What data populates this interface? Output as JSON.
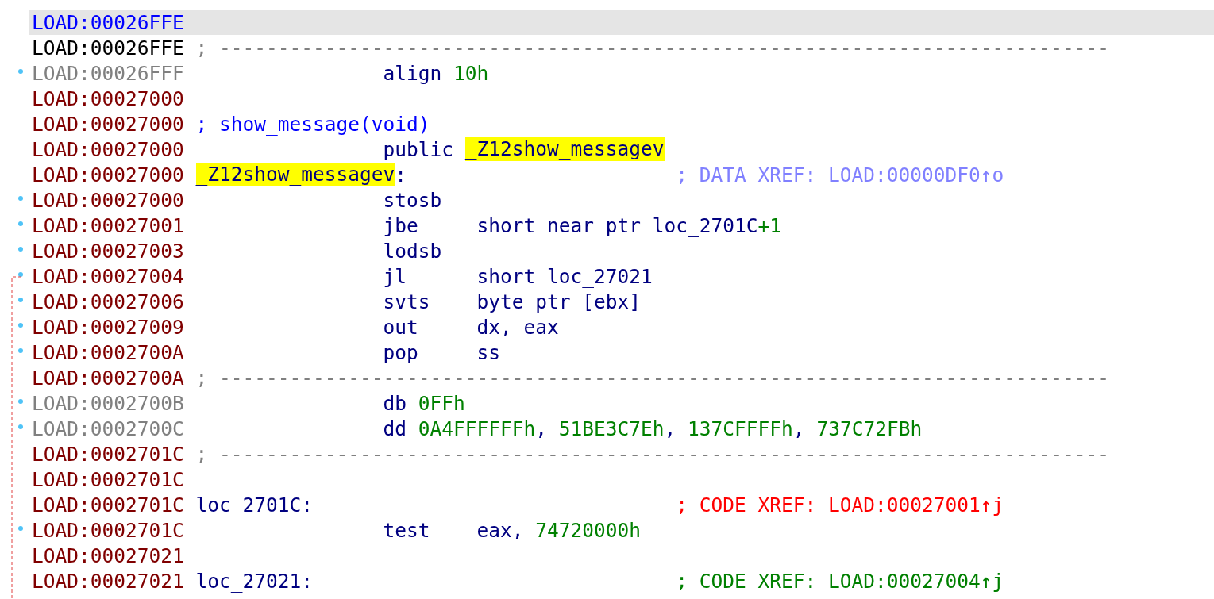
{
  "listing": {
    "lines": [
      {
        "address": "LOAD:00026FFE",
        "selected": true,
        "marker": false
      },
      {
        "address": "LOAD:00026FFE",
        "kind": "plain",
        "selected": false,
        "marker": false,
        "tokens": [
          {
            "kind": "separator",
            "parts": [
              {
                "text": "; ----------------------------------------------------------------------------",
                "kind": "separator"
              }
            ]
          }
        ]
      },
      {
        "address": "LOAD:00026FFF",
        "kind": "data",
        "selected": false,
        "marker": true,
        "tokens": [
          {
            "kind": "directive",
            "parts": [
              {
                "text": "align",
                "kind": "symbol"
              }
            ]
          },
          {
            "kind": "operands",
            "parts": [
              {
                "text": "10h",
                "kind": "number"
              }
            ]
          }
        ]
      },
      {
        "address": "LOAD:00027000",
        "kind": "code",
        "selected": false,
        "marker": false
      },
      {
        "address": "LOAD:00027000",
        "kind": "code",
        "selected": false,
        "marker": false,
        "tokens": [
          {
            "kind": "heading",
            "parts": [
              {
                "text": "; show_message(void)",
                "kind": "function"
              }
            ]
          }
        ]
      },
      {
        "address": "LOAD:00027000",
        "kind": "code",
        "selected": false,
        "marker": false,
        "tokens": [
          {
            "kind": "directive",
            "parts": [
              {
                "text": "public",
                "kind": "symbol"
              }
            ]
          },
          {
            "kind": "operands",
            "parts": [
              {
                "text": "_Z12show_messagev",
                "kind": "symbol",
                "highlighted": true
              }
            ]
          }
        ]
      },
      {
        "address": "LOAD:00027000",
        "kind": "code",
        "selected": false,
        "marker": false,
        "tokens": [
          {
            "kind": "label",
            "parts": [
              {
                "text": "_Z12show_messagev",
                "kind": "symbol",
                "highlighted": true
              },
              {
                "text": ":",
                "kind": "symbol"
              }
            ]
          },
          {
            "kind": "comment",
            "color": "#8080ff",
            "parts": [
              {
                "text": "; DATA XREF: LOAD:00000DF0↑o"
              }
            ]
          }
        ]
      },
      {
        "address": "LOAD:00027000",
        "kind": "code",
        "selected": false,
        "marker": true,
        "tokens": [
          {
            "kind": "mnemonic",
            "parts": [
              {
                "text": "stosb",
                "kind": "symbol"
              }
            ]
          }
        ]
      },
      {
        "address": "LOAD:00027001",
        "kind": "code",
        "selected": false,
        "marker": true,
        "tokens": [
          {
            "kind": "mnemonic",
            "parts": [
              {
                "text": "jbe",
                "kind": "symbol"
              }
            ]
          },
          {
            "kind": "operands",
            "parts": [
              {
                "text": "short near ptr loc_2701C",
                "kind": "symbol"
              },
              {
                "text": "+1",
                "kind": "number"
              }
            ]
          }
        ]
      },
      {
        "address": "LOAD:00027003",
        "kind": "code",
        "selected": false,
        "marker": true,
        "tokens": [
          {
            "kind": "mnemonic",
            "parts": [
              {
                "text": "lodsb",
                "kind": "symbol"
              }
            ]
          }
        ]
      },
      {
        "address": "LOAD:00027004",
        "kind": "code",
        "selected": false,
        "marker": true,
        "tokens": [
          {
            "kind": "mnemonic",
            "parts": [
              {
                "text": "jl",
                "kind": "symbol"
              }
            ]
          },
          {
            "kind": "operands",
            "parts": [
              {
                "text": "short loc_27021",
                "kind": "symbol"
              }
            ]
          }
        ]
      },
      {
        "address": "LOAD:00027006",
        "kind": "code",
        "selected": false,
        "marker": true,
        "tokens": [
          {
            "kind": "mnemonic",
            "parts": [
              {
                "text": "svts",
                "kind": "symbol"
              }
            ]
          },
          {
            "kind": "operands",
            "parts": [
              {
                "text": "byte ptr [ebx]",
                "kind": "symbol"
              }
            ]
          }
        ]
      },
      {
        "address": "LOAD:00027009",
        "kind": "code",
        "selected": false,
        "marker": true,
        "tokens": [
          {
            "kind": "mnemonic",
            "parts": [
              {
                "text": "out",
                "kind": "symbol"
              }
            ]
          },
          {
            "kind": "operands",
            "parts": [
              {
                "text": "dx, eax",
                "kind": "symbol"
              }
            ]
          }
        ]
      },
      {
        "address": "LOAD:0002700A",
        "kind": "code",
        "selected": false,
        "marker": true,
        "tokens": [
          {
            "kind": "mnemonic",
            "parts": [
              {
                "text": "pop",
                "kind": "symbol"
              }
            ]
          },
          {
            "kind": "operands",
            "parts": [
              {
                "text": "ss",
                "kind": "symbol"
              }
            ]
          }
        ]
      },
      {
        "address": "LOAD:0002700A",
        "kind": "code",
        "selected": false,
        "marker": false,
        "tokens": [
          {
            "kind": "separator",
            "parts": [
              {
                "text": "; ----------------------------------------------------------------------------",
                "kind": "separator"
              }
            ]
          }
        ]
      },
      {
        "address": "LOAD:0002700B",
        "kind": "data",
        "selected": false,
        "marker": true,
        "tokens": [
          {
            "kind": "directive",
            "parts": [
              {
                "text": "db",
                "kind": "symbol"
              }
            ]
          },
          {
            "kind": "operands",
            "parts": [
              {
                "text": "0FFh",
                "kind": "number"
              }
            ]
          }
        ]
      },
      {
        "address": "LOAD:0002700C",
        "kind": "data",
        "selected": false,
        "marker": true,
        "tokens": [
          {
            "kind": "directive",
            "parts": [
              {
                "text": "dd",
                "kind": "symbol"
              }
            ]
          },
          {
            "kind": "operands",
            "parts": [
              {
                "text": "0A4FFFFFFh",
                "kind": "number"
              },
              {
                "text": ", ",
                "kind": "symbol"
              },
              {
                "text": "51BE3C7Eh",
                "kind": "number"
              },
              {
                "text": ", ",
                "kind": "symbol"
              },
              {
                "text": "137CFFFFh",
                "kind": "number"
              },
              {
                "text": ", ",
                "kind": "symbol"
              },
              {
                "text": "737C72FBh",
                "kind": "number"
              }
            ]
          }
        ]
      },
      {
        "address": "LOAD:0002701C",
        "kind": "code",
        "selected": false,
        "marker": false,
        "tokens": [
          {
            "kind": "separator",
            "parts": [
              {
                "text": "; ----------------------------------------------------------------------------",
                "kind": "separator"
              }
            ]
          }
        ]
      },
      {
        "address": "LOAD:0002701C",
        "kind": "code",
        "selected": false,
        "marker": false
      },
      {
        "address": "LOAD:0002701C",
        "kind": "code",
        "selected": false,
        "marker": false,
        "tokens": [
          {
            "kind": "label",
            "parts": [
              {
                "text": "loc_2701C:",
                "kind": "symbol"
              }
            ]
          },
          {
            "kind": "comment",
            "color": "#ff0000",
            "parts": [
              {
                "text": "; CODE XREF: LOAD:00027001↑j"
              }
            ]
          }
        ]
      },
      {
        "address": "LOAD:0002701C",
        "kind": "code",
        "selected": false,
        "marker": true,
        "tokens": [
          {
            "kind": "mnemonic",
            "parts": [
              {
                "text": "test",
                "kind": "symbol"
              }
            ]
          },
          {
            "kind": "operands",
            "parts": [
              {
                "text": "eax, ",
                "kind": "symbol"
              },
              {
                "text": "74720000h",
                "kind": "number"
              }
            ]
          }
        ]
      },
      {
        "address": "LOAD:00027021",
        "kind": "code",
        "selected": false,
        "marker": false
      },
      {
        "address": "LOAD:00027021",
        "kind": "code",
        "selected": false,
        "marker": false,
        "tokens": [
          {
            "kind": "label",
            "parts": [
              {
                "text": "loc_27021:",
                "kind": "symbol"
              }
            ]
          },
          {
            "kind": "comment",
            "color": "#008000",
            "parts": [
              {
                "text": "; CODE XREF: LOAD:00027004↑j"
              }
            ]
          }
        ]
      }
    ]
  }
}
